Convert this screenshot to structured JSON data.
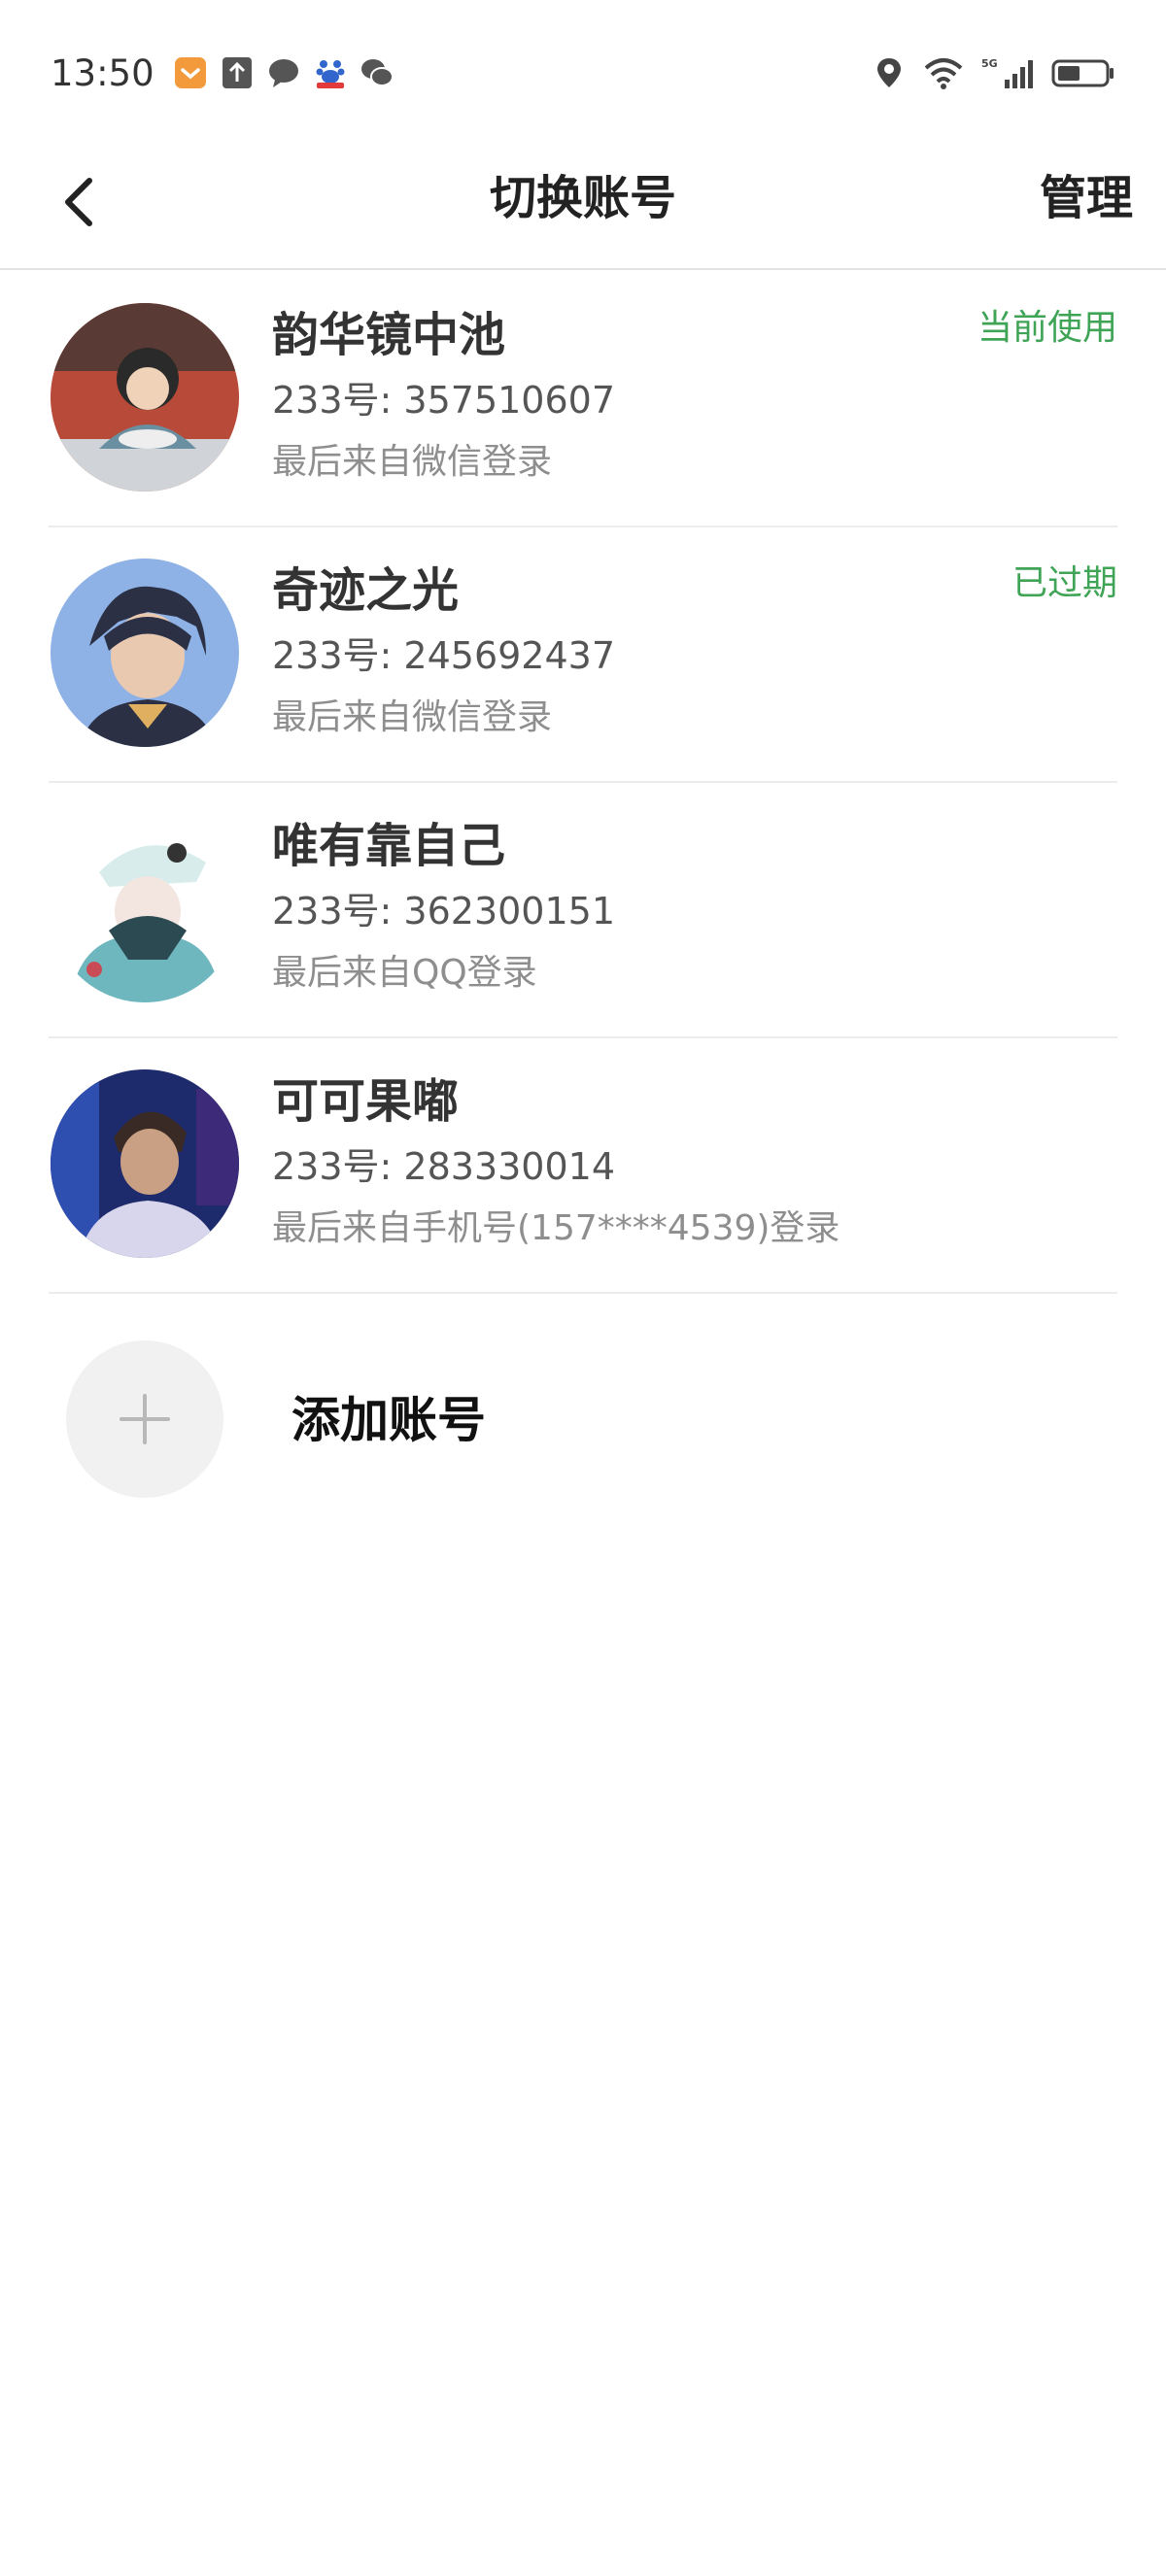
{
  "status_bar": {
    "time": "13:50",
    "left_icons": [
      "app-notification-icon",
      "upload-icon",
      "message-icon",
      "baidu-icon",
      "wechat-icon"
    ],
    "right_icons": [
      "location-icon",
      "wifi-icon",
      "5g-signal-icon",
      "battery-icon"
    ],
    "network": "5G"
  },
  "nav": {
    "title": "切换账号",
    "manage_label": "管理",
    "back_icon": "chevron-left-icon"
  },
  "accounts": [
    {
      "name": "韵华镜中池",
      "id_line": "233号: 357510607",
      "login_line": "最后来自微信登录",
      "status": "当前使用",
      "avatar_colors": [
        "#b84a3a",
        "#6a8fa0",
        "#d0d4d8"
      ]
    },
    {
      "name": "奇迹之光",
      "id_line": "233号: 245692437",
      "login_line": "最后来自微信登录",
      "status": "已过期",
      "avatar_colors": [
        "#8fb2e6",
        "#2b3045",
        "#e9c9b0"
      ]
    },
    {
      "name": "唯有靠自己",
      "id_line": "233号: 362300151",
      "login_line": "最后来自QQ登录",
      "status": "",
      "avatar_colors": [
        "#ffffff",
        "#6fb7be",
        "#c94b55"
      ]
    },
    {
      "name": "可可果嘟",
      "id_line": "233号: 283330014",
      "login_line": "最后来自手机号(157****4539)登录",
      "status": "",
      "avatar_colors": [
        "#1d2a6b",
        "#d8d6ec",
        "#caa084"
      ]
    }
  ],
  "add_account": {
    "label": "添加账号",
    "icon": "plus-icon"
  },
  "colors": {
    "accent_green": "#3fa456",
    "divider": "#ececec",
    "secondary_text": "#8e8e8e"
  }
}
